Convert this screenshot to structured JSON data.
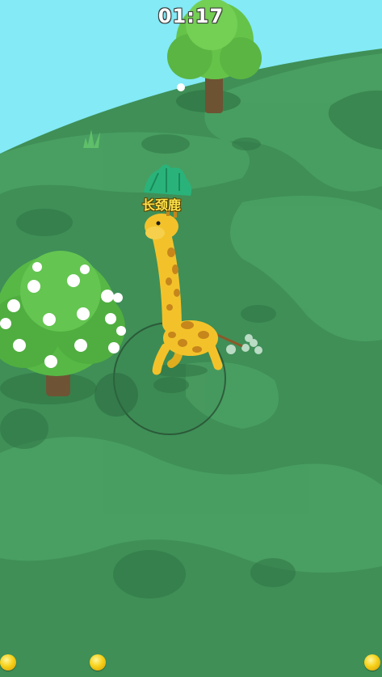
{
  "hud": {
    "timer": "01:17"
  },
  "player": {
    "name": "长颈鹿",
    "icon": "giraffe-character"
  },
  "joystick": {
    "icon": "virtual-joystick"
  },
  "bottom_items": [
    "coin-icon",
    "coin-icon",
    "coin-icon"
  ],
  "colors": {
    "sky": "#7fe8f5",
    "grass": "#3e8f58",
    "grass_light": "#4a9d62",
    "giraffe": "#f3c22a",
    "giraffe_spots": "#c6861b",
    "label": "#ffe34a"
  }
}
